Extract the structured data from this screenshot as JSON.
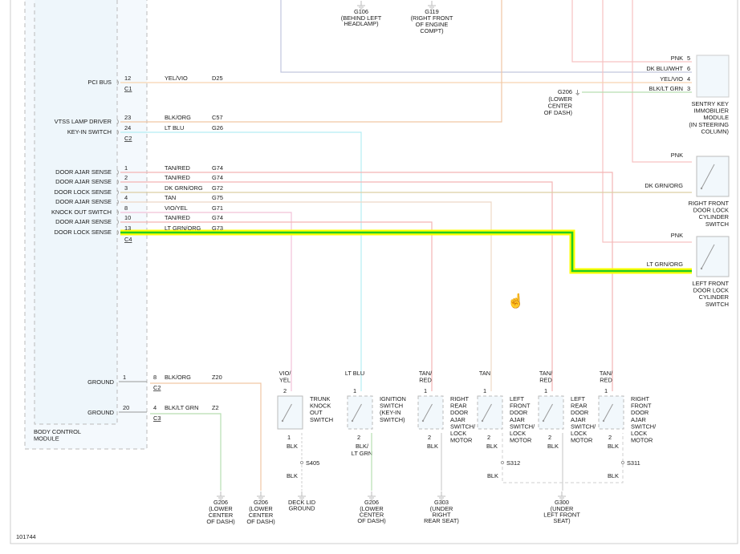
{
  "diagram_id": "101744",
  "highlight_colors": {
    "outer": "#ffff00",
    "inner": "#22cc22"
  },
  "wire_colors": {
    "pnk": "#f6c2c2",
    "tan_red": "#f4b4b4",
    "tan": "#eed8c6",
    "yel_vio": "#f6d4b0",
    "blk_org": "#f0c6a4",
    "dk_grn_org": "#dccfa4",
    "lt_blu": "#b4eef4",
    "dk_blu_wht": "#c2c6de",
    "blk_lt_grn": "#b6deb0",
    "vio_yel": "#f2c2d8",
    "blk": "#cfcfcf"
  },
  "module": {
    "name_lines": [
      "BODY CONTROL",
      "MODULE"
    ]
  },
  "bcm_rows": [
    {
      "label": "PCI BUS",
      "pin": "12",
      "wire": "YEL/VIO",
      "circuit": "D25"
    },
    {
      "label": "VTSS LAMP DRIVER",
      "pin": "23",
      "wire": "BLK/ORG",
      "circuit": "C57"
    },
    {
      "label": "KEY-IN SWITCH",
      "pin": "24",
      "wire": "LT BLU",
      "circuit": "G26"
    },
    {
      "label": "DOOR AJAR SENSE",
      "pin": "1",
      "wire": "TAN/RED",
      "circuit": "G74"
    },
    {
      "label": "DOOR AJAR SENSE",
      "pin": "2",
      "wire": "TAN/RED",
      "circuit": "G74"
    },
    {
      "label": "DOOR LOCK SENSE",
      "pin": "3",
      "wire": "DK GRN/ORG",
      "circuit": "G72"
    },
    {
      "label": "DOOR AJAR SENSE",
      "pin": "4",
      "wire": "TAN",
      "circuit": "G75"
    },
    {
      "label": "KNOCK OUT SWITCH",
      "pin": "8",
      "wire": "VIO/YEL",
      "circuit": "G71"
    },
    {
      "label": "DOOR AJAR SENSE",
      "pin": "10",
      "wire": "TAN/RED",
      "circuit": "G74"
    },
    {
      "label": "DOOR LOCK SENSE",
      "pin": "13",
      "wire": "LT GRN/ORG",
      "circuit": "G73"
    }
  ],
  "bcm_connectors": [
    "C1",
    "C2",
    "C4"
  ],
  "ground_rows": [
    {
      "label": "GROUND",
      "pin": "1",
      "mate_pin": "8",
      "wire": "BLK/ORG",
      "circuit": "Z20",
      "connector": "C2"
    },
    {
      "label": "GROUND",
      "pin": "20",
      "mate_pin": "4",
      "wire": "BLK/LT GRN",
      "circuit": "Z2",
      "connector": "C3"
    }
  ],
  "top_grounds": [
    {
      "id": "G106",
      "lines": [
        "(BEHIND LEFT",
        "HEADLAMP)"
      ]
    },
    {
      "id": "G119",
      "lines": [
        "(RIGHT FRONT",
        "OF ENGINE",
        "COMPT)"
      ]
    }
  ],
  "immobilizer": {
    "pins": [
      {
        "wire": "PNK",
        "pin": "5"
      },
      {
        "wire": "DK BLU/WHT",
        "pin": "6"
      },
      {
        "wire": "YEL/VIO",
        "pin": "4"
      },
      {
        "wire": "BLK/LT GRN",
        "pin": "3"
      }
    ],
    "name_lines": [
      "SENTRY KEY",
      "IMMOBILIER",
      "MODULE",
      "(IN STEERING",
      "COLUMN)"
    ],
    "ground": {
      "id": "G206",
      "lines": [
        "(LOWER",
        "CENTER",
        "OF DASH)"
      ]
    }
  },
  "lock_cylinders": [
    {
      "wires": [
        "PNK",
        "DK GRN/ORG"
      ],
      "name_lines": [
        "RIGHT FRONT",
        "DOOR LOCK",
        "CYLINDER",
        "SWITCH"
      ]
    },
    {
      "wires": [
        "PNK",
        "LT GRN/ORG"
      ],
      "name_lines": [
        "LEFT FRONT",
        "DOOR LOCK",
        "CYLINDER",
        "SWITCH"
      ]
    }
  ],
  "switches": [
    {
      "wire_lines": [
        "VIO/",
        "YEL"
      ],
      "pin_top": "2",
      "pin_bottom": "1",
      "name_lines": [
        "TRUNK",
        "KNOCK",
        "OUT",
        "SWITCH"
      ],
      "bottom_wire_lines": [
        "BLK"
      ]
    },
    {
      "wire_lines": [
        "LT BLU"
      ],
      "pin_top": "1",
      "pin_bottom": "2",
      "name_lines": [
        "IGNITION",
        "SWITCH",
        "(KEY-IN",
        "SWITCH)"
      ],
      "bottom_wire_lines": [
        "BLK/",
        "LT GRN"
      ]
    },
    {
      "wire_lines": [
        "TAN/",
        "RED"
      ],
      "pin_top": "1",
      "pin_bottom": "2",
      "name_lines": [
        "RIGHT",
        "REAR",
        "DOOR",
        "AJAR",
        "SWITCH/",
        "LOCK",
        "MOTOR"
      ],
      "bottom_wire_lines": [
        "BLK"
      ]
    },
    {
      "wire_lines": [
        "TAN"
      ],
      "pin_top": "1",
      "pin_bottom": "2",
      "name_lines": [
        "LEFT",
        "FRONT",
        "DOOR",
        "AJAR",
        "SWITCH/",
        "LOCK",
        "MOTOR"
      ],
      "bottom_wire_lines": [
        "BLK"
      ]
    },
    {
      "wire_lines": [
        "TAN/",
        "RED"
      ],
      "pin_top": "1",
      "pin_bottom": "2",
      "name_lines": [
        "LEFT",
        "REAR",
        "DOOR",
        "AJAR",
        "SWITCH/",
        "LOCK",
        "MOTOR"
      ],
      "bottom_wire_lines": [
        "BLK"
      ]
    },
    {
      "wire_lines": [
        "TAN/",
        "RED"
      ],
      "pin_top": "1",
      "pin_bottom": "2",
      "name_lines": [
        "RIGHT",
        "FRONT",
        "DOOR",
        "AJAR",
        "SWITCH/",
        "LOCK",
        "MOTOR"
      ],
      "bottom_wire_lines": [
        "BLK"
      ]
    }
  ],
  "splices": [
    {
      "id": "S405",
      "wire_after": "BLK"
    },
    {
      "id": "S312",
      "wire_after": "BLK"
    },
    {
      "id": "S311",
      "wire_after": "BLK"
    }
  ],
  "bottom_grounds": [
    {
      "id": "G206",
      "lines": [
        "(LOWER",
        "CENTER",
        "OF DASH)"
      ]
    },
    {
      "id": "G206",
      "lines": [
        "(LOWER",
        "CENTER",
        "OF DASH)"
      ]
    },
    {
      "id": "",
      "lines": [
        "DECK LID",
        "GROUND"
      ]
    },
    {
      "id": "G206",
      "lines": [
        "(LOWER",
        "CENTER",
        "OF DASH)"
      ]
    },
    {
      "id": "G303",
      "lines": [
        "(UNDER",
        "RIGHT",
        "REAR SEAT)"
      ]
    },
    {
      "id": "G300",
      "lines": [
        "(UNDER",
        "LEFT FRONT",
        "SEAT)"
      ]
    }
  ],
  "cursor_icon": "hand-pointer-icon"
}
